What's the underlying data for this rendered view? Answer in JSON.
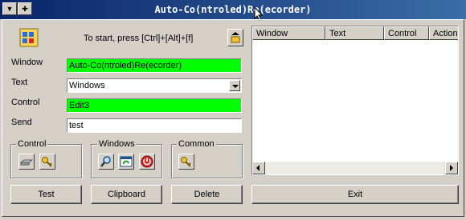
{
  "window": {
    "title": "Auto-Co(ntroled)Re(ecorder)",
    "system_menu_icon": "down-arrow-icon",
    "pin_icon": "pin-icon"
  },
  "header": {
    "app_icon": "folder-icon",
    "hint": "To start, press [Ctrl]+[Alt]+[f]",
    "side_button_icon": "record-icon"
  },
  "form": {
    "window_label": "Window",
    "window_value": "Auto-Co(ntroled)Re(ecorder)",
    "text_label": "Text",
    "text_value": "Windows",
    "control_label": "Control",
    "control_value": "Edit3",
    "send_label": "Send",
    "send_value": "test"
  },
  "groups": {
    "control": {
      "label": "Control",
      "icons": [
        "drive-icon",
        "key-icon"
      ]
    },
    "windows": {
      "label": "Windows",
      "icons": [
        "magnifier-icon",
        "window-refresh-icon",
        "power-icon"
      ]
    },
    "common": {
      "label": "Common",
      "icons": [
        "key-icon"
      ]
    }
  },
  "buttons": {
    "test": "Test",
    "clipboard": "Clipboard",
    "delete": "Delete",
    "exit": "Exit"
  },
  "list": {
    "columns": [
      "Window",
      "Text",
      "Control",
      "Action"
    ],
    "rows": []
  },
  "colors": {
    "title_bar": "#0a246a",
    "highlight_field": "#00ff00",
    "face": "#d4d0c8"
  }
}
